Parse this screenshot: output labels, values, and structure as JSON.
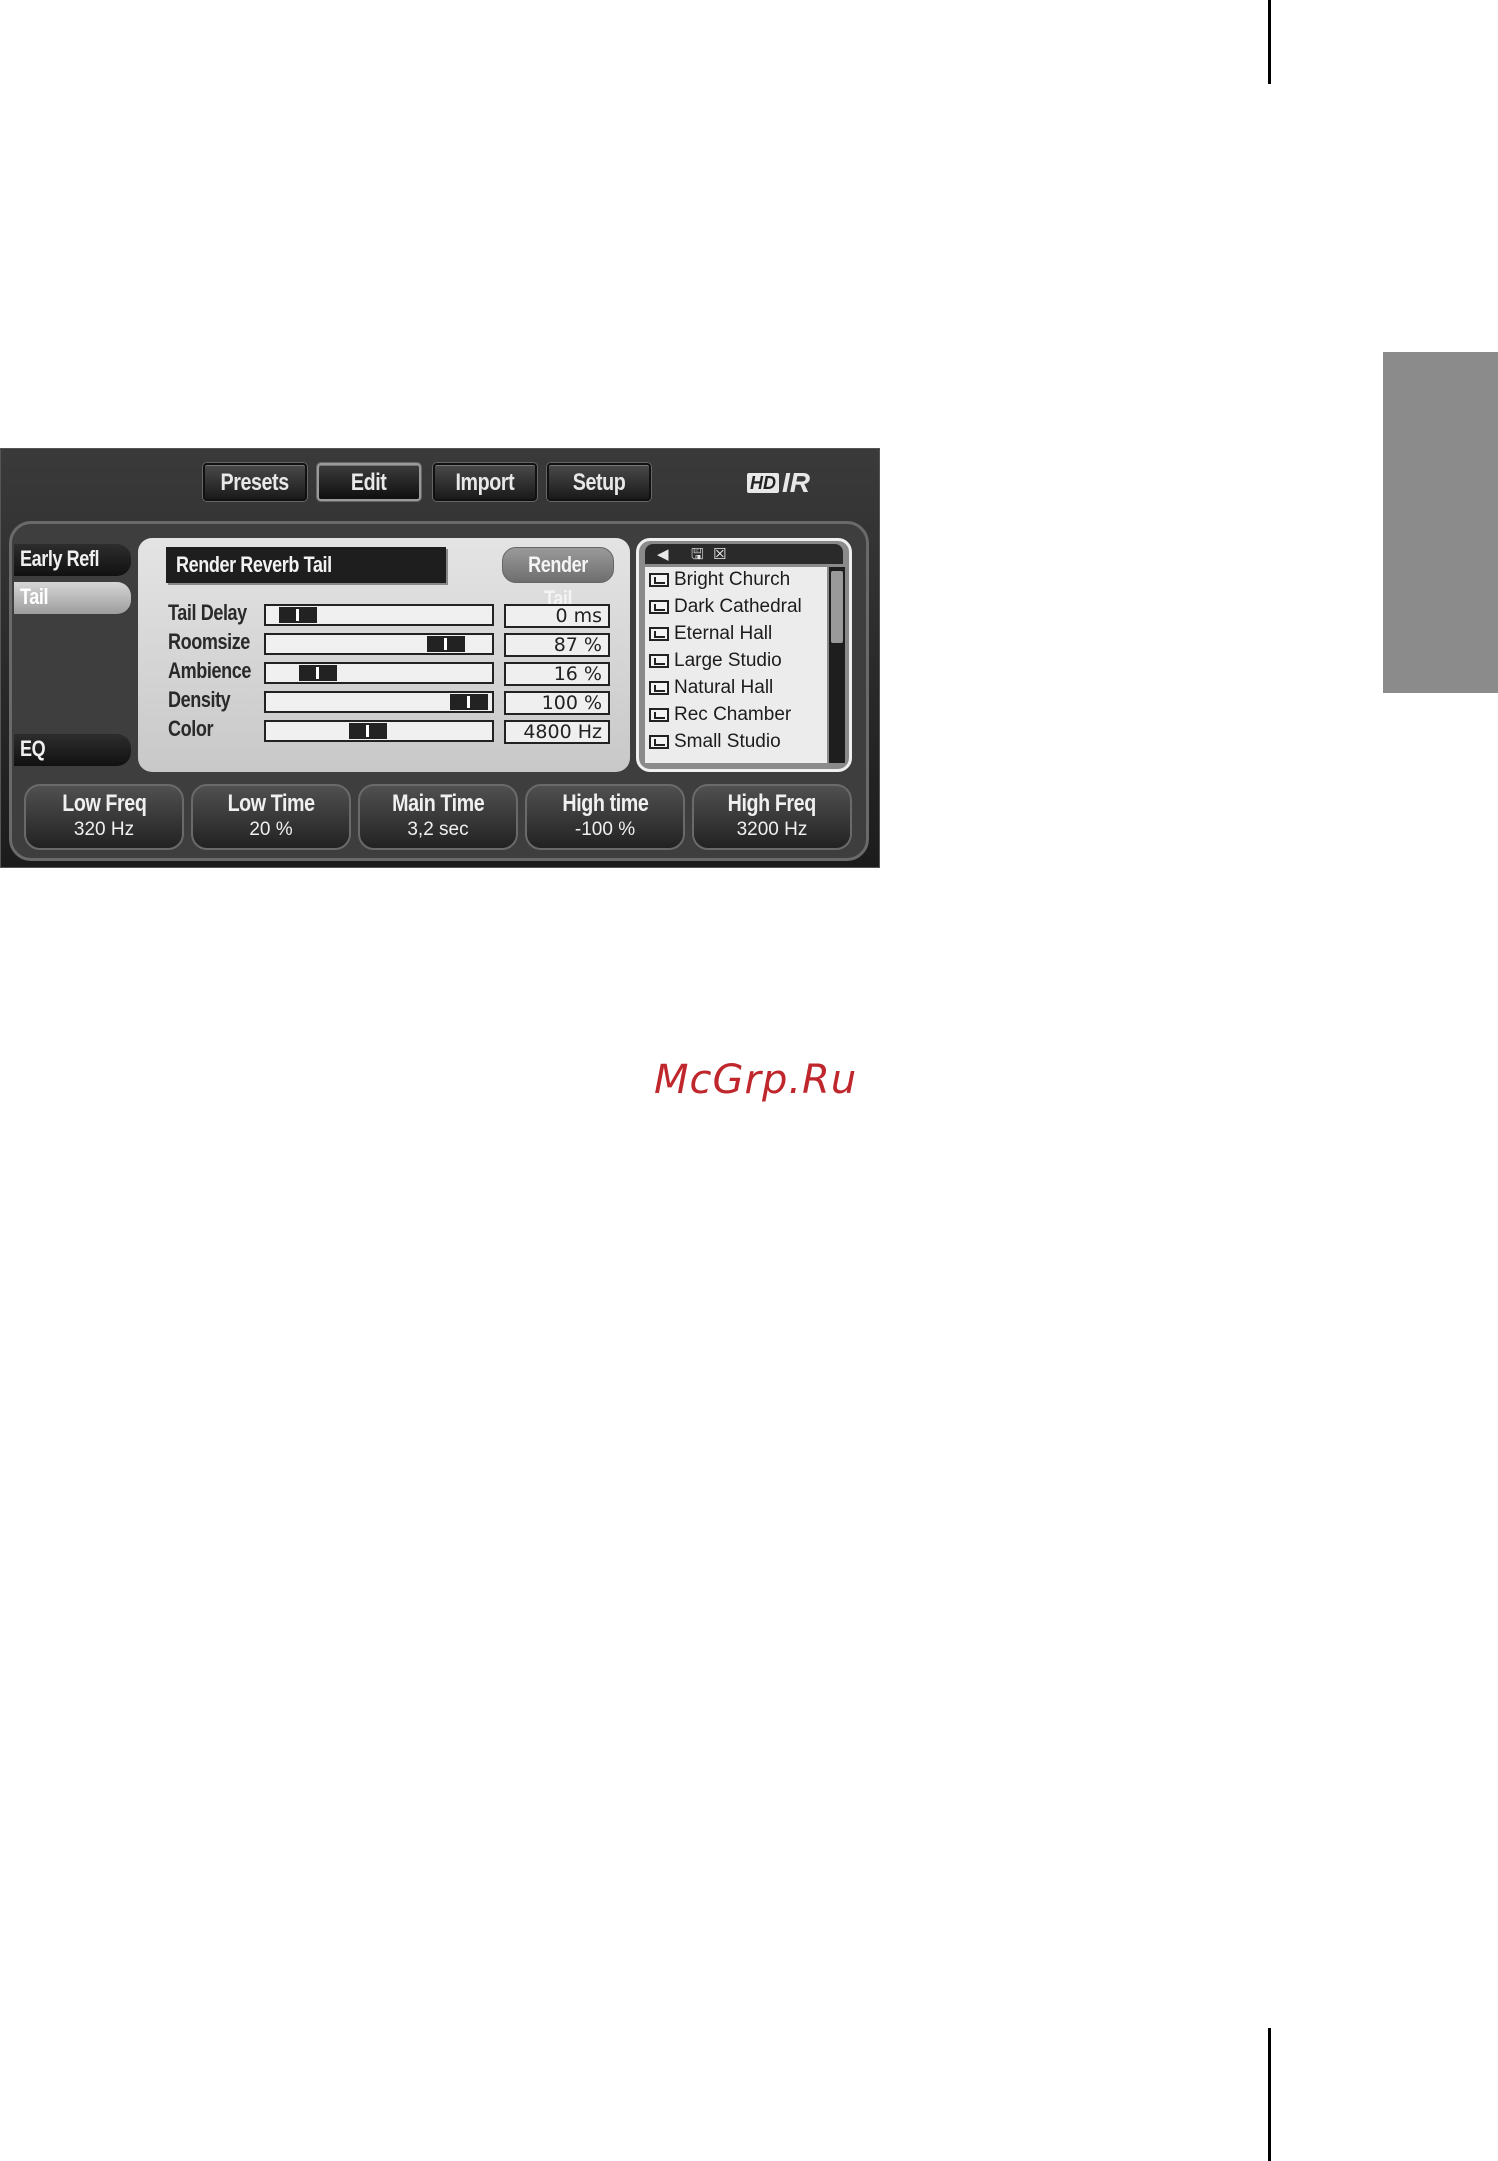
{
  "page": {
    "watermark": "McGrp.Ru"
  },
  "plugin": {
    "logo": {
      "badge": "HD",
      "text": "IR"
    },
    "top_menu": [
      {
        "label": "Presets"
      },
      {
        "label": "Edit"
      },
      {
        "label": "Import"
      },
      {
        "label": "Setup"
      }
    ],
    "sections": [
      {
        "label": "Early Refl"
      },
      {
        "label": "Tail"
      },
      {
        "label": "EQ"
      }
    ],
    "editor": {
      "title": "Render Reverb Tail",
      "render_button": "Render Tail",
      "params": [
        {
          "label": "Tail Delay",
          "value": "0 ms",
          "position": 0.05
        },
        {
          "label": "Roomsize",
          "value": "87 %",
          "position": 0.87
        },
        {
          "label": "Ambience",
          "value": "16 %",
          "position": 0.16
        },
        {
          "label": "Density",
          "value": "100 %",
          "position": 1.0
        },
        {
          "label": "Color",
          "value": "4800 Hz",
          "position": 0.44
        }
      ]
    },
    "browser": {
      "icons": [
        "back-icon",
        "save-icon",
        "close-icon"
      ],
      "items": [
        "Bright Church",
        "Dark Cathedral",
        "Eternal Hall",
        "Large Studio",
        "Natural Hall",
        "Rec Chamber",
        "Small Studio"
      ]
    },
    "knobs": [
      {
        "label": "Low Freq",
        "value": "320 Hz"
      },
      {
        "label": "Low Time",
        "value": "20 %"
      },
      {
        "label": "Main Time",
        "value": "3,2 sec"
      },
      {
        "label": "High time",
        "value": "-100 %"
      },
      {
        "label": "High Freq",
        "value": "3200 Hz"
      }
    ]
  }
}
